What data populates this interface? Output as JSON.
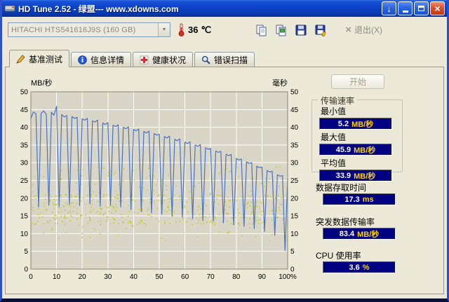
{
  "window": {
    "title": "HD Tune 2.52 - 绿盟--- www.xdowns.com"
  },
  "icons": {
    "app": "hard-disk-icon",
    "titlebar": [
      "download-arrow-icon",
      "minimize-icon",
      "maximize-icon",
      "close-icon"
    ],
    "toolbar": [
      "thermometer-icon",
      "copy-pages-icon",
      "copy-image-icon",
      "floppy-save-icon",
      "floppy-save-image-icon",
      "exit-x-icon",
      "chevron-down-icon"
    ],
    "tabs": [
      "benchmark-icon",
      "info-icon",
      "health-icon",
      "error-scan-icon"
    ]
  },
  "toolbar": {
    "drive": "HITACHI HTS541616J9S (160 GB)",
    "temperature": "36",
    "temp_unit": "℃",
    "exit_label": "退出(X)"
  },
  "tabs": [
    {
      "label": "基准测试",
      "active": true
    },
    {
      "label": "信息详情",
      "active": false
    },
    {
      "label": "健康状况",
      "active": false
    },
    {
      "label": "错误扫描",
      "active": false
    }
  ],
  "panel": {
    "start_label": "开始",
    "transfer_group": {
      "title": "传输速率",
      "rows": [
        {
          "label": "最小值",
          "value": "5.2",
          "unit": "MB/秒"
        },
        {
          "label": "最大值",
          "value": "45.9",
          "unit": "MB/秒"
        },
        {
          "label": "平均值",
          "value": "33.9",
          "unit": "MB/秒"
        }
      ]
    },
    "stats": [
      {
        "label": "数据存取时间",
        "value": "17.3",
        "unit": "ms"
      },
      {
        "label": "突发数据传输率",
        "value": "83.4",
        "unit": "MB/秒"
      },
      {
        "label": "CPU 使用率",
        "value": "3.6",
        "unit": "%"
      }
    ]
  },
  "chart_data": {
    "type": "line+scatter",
    "y_left_label": "MB/秒",
    "y_right_label": "毫秒",
    "ylim": [
      0,
      50
    ],
    "xlim": [
      0,
      100
    ],
    "y_ticks": [
      50,
      45,
      40,
      35,
      30,
      25,
      20,
      15,
      10,
      5,
      0
    ],
    "x_tick_labels": [
      "0",
      "10",
      "20",
      "30",
      "40",
      "50",
      "60",
      "70",
      "80",
      "90",
      "100%"
    ],
    "grid": true,
    "plot_bg": "#d9d5c7",
    "grid_color": "#ffffff",
    "border_color": "#8a8677",
    "series": [
      {
        "name": "传输速率",
        "type": "line",
        "color": "#4a74c0",
        "points": [
          [
            0,
            42.5
          ],
          [
            1,
            44.3
          ],
          [
            2,
            43.8
          ],
          [
            3,
            17.5
          ],
          [
            4,
            43.9
          ],
          [
            5,
            44.6
          ],
          [
            6,
            43.6
          ],
          [
            7,
            18.0
          ],
          [
            8,
            44.2
          ],
          [
            9,
            43.4
          ],
          [
            10,
            45.9
          ],
          [
            11,
            17.6
          ],
          [
            12,
            43.6
          ],
          [
            13,
            42.9
          ],
          [
            14,
            43.3
          ],
          [
            15,
            18.2
          ],
          [
            16,
            43.0
          ],
          [
            17,
            42.5
          ],
          [
            18,
            42.8
          ],
          [
            19,
            17.9
          ],
          [
            20,
            42.4
          ],
          [
            21,
            42.0
          ],
          [
            22,
            42.5
          ],
          [
            23,
            18.4
          ],
          [
            24,
            41.8
          ],
          [
            25,
            41.5
          ],
          [
            26,
            42.0
          ],
          [
            27,
            17.7
          ],
          [
            28,
            41.2
          ],
          [
            29,
            40.8
          ],
          [
            30,
            41.3
          ],
          [
            31,
            18.0
          ],
          [
            32,
            40.6
          ],
          [
            33,
            40.2
          ],
          [
            34,
            40.7
          ],
          [
            35,
            17.5
          ],
          [
            36,
            40.0
          ],
          [
            37,
            39.6
          ],
          [
            38,
            40.1
          ],
          [
            39,
            16.8
          ],
          [
            40,
            39.4
          ],
          [
            41,
            39.0
          ],
          [
            42,
            39.5
          ],
          [
            43,
            16.2
          ],
          [
            44,
            38.8
          ],
          [
            45,
            38.4
          ],
          [
            46,
            38.9
          ],
          [
            47,
            15.8
          ],
          [
            48,
            38.2
          ],
          [
            49,
            37.8
          ],
          [
            50,
            38.0
          ],
          [
            51,
            15.5
          ],
          [
            52,
            37.4
          ],
          [
            53,
            37.0
          ],
          [
            54,
            37.5
          ],
          [
            55,
            15.0
          ],
          [
            56,
            36.6
          ],
          [
            57,
            36.2
          ],
          [
            58,
            36.7
          ],
          [
            59,
            14.6
          ],
          [
            60,
            35.8
          ],
          [
            61,
            35.4
          ],
          [
            62,
            35.9
          ],
          [
            63,
            14.2
          ],
          [
            64,
            35.0
          ],
          [
            65,
            34.6
          ],
          [
            66,
            35.1
          ],
          [
            67,
            13.8
          ],
          [
            68,
            34.2
          ],
          [
            69,
            33.8
          ],
          [
            70,
            34.0
          ],
          [
            71,
            13.4
          ],
          [
            72,
            33.3
          ],
          [
            73,
            32.9
          ],
          [
            74,
            33.2
          ],
          [
            75,
            13.0
          ],
          [
            76,
            32.4
          ],
          [
            77,
            32.0
          ],
          [
            78,
            32.3
          ],
          [
            79,
            12.5
          ],
          [
            80,
            31.2
          ],
          [
            81,
            30.8
          ],
          [
            82,
            31.0
          ],
          [
            83,
            12.0
          ],
          [
            84,
            30.2
          ],
          [
            85,
            29.8
          ],
          [
            86,
            30.0
          ],
          [
            87,
            11.4
          ],
          [
            88,
            29.0
          ],
          [
            89,
            28.6
          ],
          [
            90,
            28.8
          ],
          [
            91,
            10.6
          ],
          [
            92,
            27.8
          ],
          [
            93,
            27.4
          ],
          [
            94,
            27.6
          ],
          [
            95,
            9.5
          ],
          [
            96,
            26.6
          ],
          [
            97,
            26.2
          ],
          [
            98,
            26.4
          ],
          [
            99,
            5.2
          ],
          [
            100,
            25.5
          ]
        ]
      },
      {
        "name": "存取时间",
        "type": "scatter",
        "color": "#c3c31d",
        "generator": {
          "seed": 97,
          "count": 520,
          "x_min": 0,
          "x_max": 100,
          "bands": [
            {
              "p": 0.72,
              "y_min": 12.5,
              "y_max": 21.0
            },
            {
              "p": 0.92,
              "y_min": 20.0,
              "y_max": 29.0
            },
            {
              "p": 1.0,
              "y_min": 8.0,
              "y_max": 13.0
            }
          ]
        }
      }
    ]
  }
}
